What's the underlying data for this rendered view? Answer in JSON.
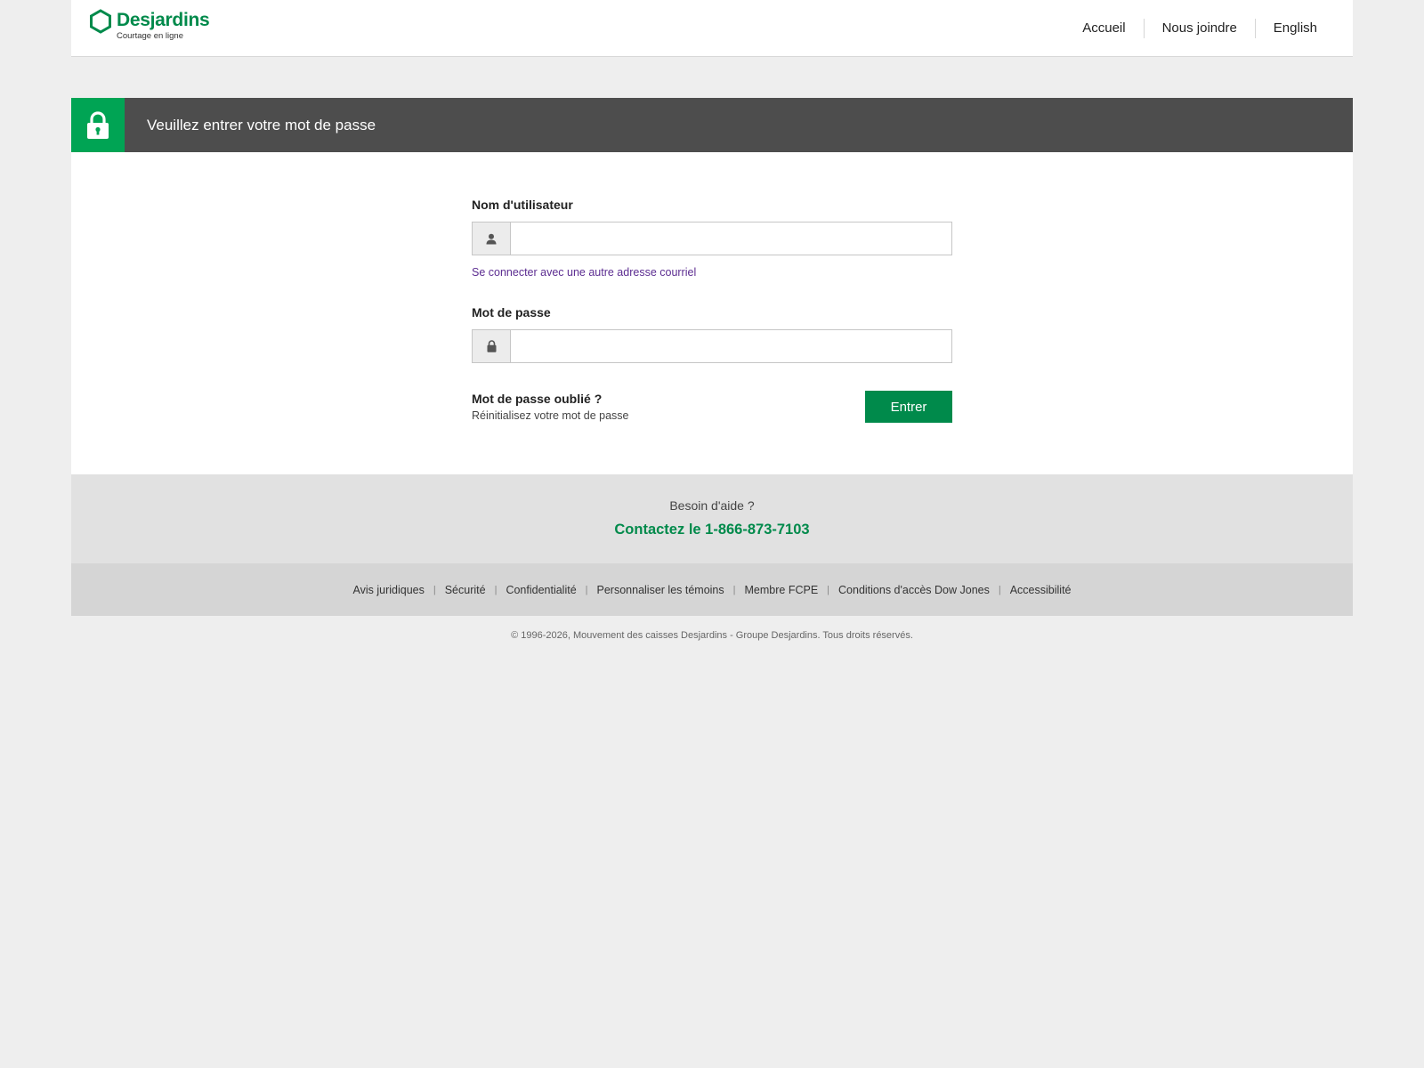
{
  "brand": {
    "name": "Desjardins",
    "subtitle": "Courtage en ligne",
    "color": "#008a4b"
  },
  "nav": {
    "items": [
      {
        "label": "Accueil"
      },
      {
        "label": "Nous joindre"
      },
      {
        "label": "English"
      }
    ]
  },
  "banner": {
    "title": "Veuillez entrer votre mot de passe",
    "icon": "lock-icon",
    "icon_bg": "#00a454",
    "bg": "#4d4d4d"
  },
  "form": {
    "username_label": "Nom d'utilisateur",
    "username_value": "",
    "username_icon": "user-icon",
    "alt_email_link": "Se connecter avec une autre adresse courriel",
    "password_label": "Mot de passe",
    "password_value": "",
    "password_icon": "lock-icon",
    "forgot_title": "Mot de passe oublié ?",
    "forgot_link": "Réinitialisez votre mot de passe",
    "submit_label": "Entrer"
  },
  "help": {
    "question": "Besoin d'aide ?",
    "phone_label": "Contactez le 1-866-873-7103"
  },
  "footer": {
    "links": [
      {
        "label": "Avis juridiques"
      },
      {
        "label": "Sécurité"
      },
      {
        "label": "Confidentialité"
      },
      {
        "label": "Personnaliser les témoins"
      },
      {
        "label": "Membre FCPE"
      },
      {
        "label": "Conditions d'accès Dow Jones"
      },
      {
        "label": "Accessibilité"
      }
    ],
    "separator": "|",
    "copyright": "© 1996-2026, Mouvement des caisses Desjardins - Groupe Desjardins. Tous droits réservés."
  }
}
